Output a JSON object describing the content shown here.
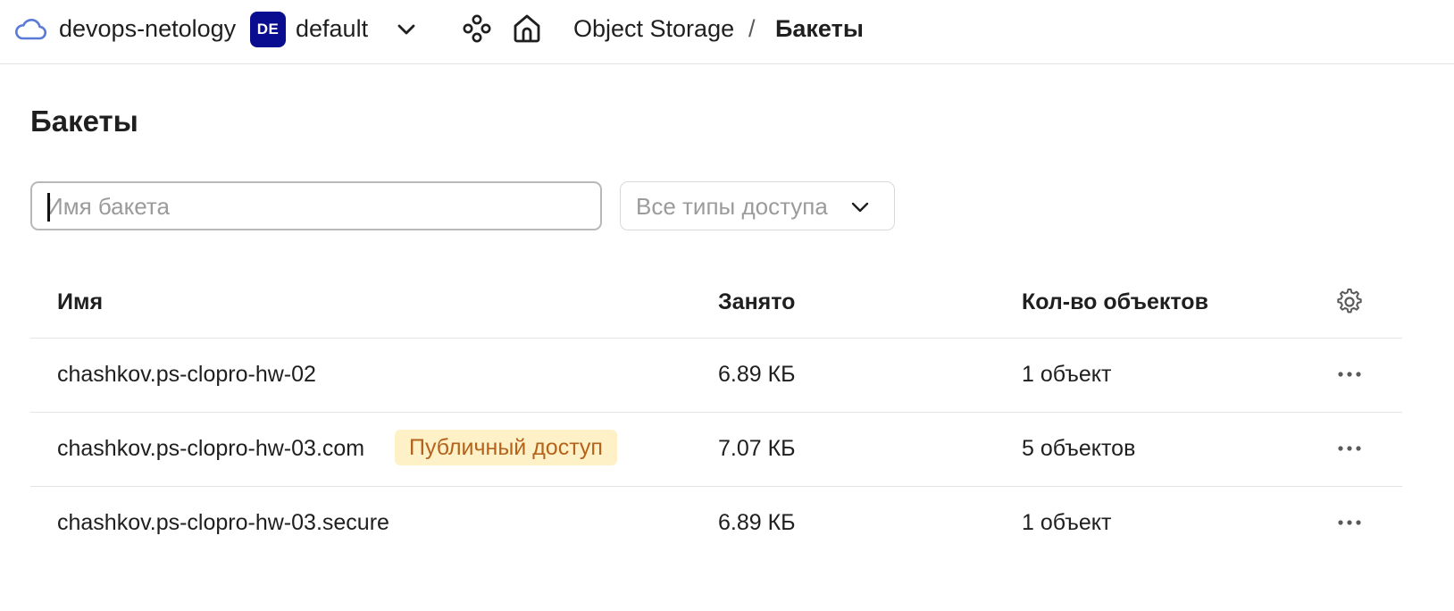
{
  "header": {
    "cloud_name": "devops-netology",
    "folder_badge": "DE",
    "folder_name": "default",
    "breadcrumb": {
      "service": "Object Storage",
      "separator": "/",
      "current": "Бакеты"
    },
    "icons": [
      "cloud-icon",
      "chevron-down-icon",
      "services-icon",
      "home-icon"
    ]
  },
  "page": {
    "title": "Бакеты"
  },
  "filters": {
    "search": {
      "placeholder": "Имя бакета",
      "value": ""
    },
    "access_type": {
      "selected": "Все типы доступа"
    }
  },
  "table": {
    "columns": {
      "name": "Имя",
      "size": "Занято",
      "count": "Кол-во объектов"
    },
    "rows": [
      {
        "name": "chashkov.ps-clopro-hw-02",
        "badge": "",
        "size": "6.89 КБ",
        "count": "1 объект"
      },
      {
        "name": "chashkov.ps-clopro-hw-03.com",
        "badge": "Публичный доступ",
        "size": "7.07 КБ",
        "count": "5 объектов"
      },
      {
        "name": "chashkov.ps-clopro-hw-03.secure",
        "badge": "",
        "size": "6.89 КБ",
        "count": "1 объект"
      }
    ]
  },
  "colors": {
    "folder_badge_bg": "#0a0d8f",
    "public_badge_bg": "#fef1c7",
    "public_badge_text": "#b4631c",
    "cloud_icon": "#5b7ad8"
  }
}
